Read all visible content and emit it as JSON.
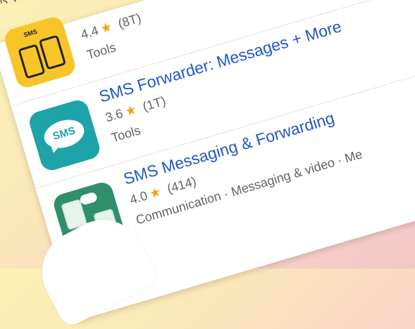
{
  "header_text": [
    "गए ऐसे डोमेन फेल"
  ],
  "apps": [
    {
      "name": "",
      "rating": "4.4",
      "reviews": "(8T)",
      "category": "Tools",
      "icon": "sms-phones-icon",
      "icon_color": "#f7c52a"
    },
    {
      "name": "SMS Forwarder: Messages + More",
      "rating": "3.6",
      "reviews": "(1T)",
      "category": "Tools",
      "icon": "sms-bubble-icon",
      "icon_color": "#1ea3a8",
      "icon_text": "SMS"
    },
    {
      "name": "SMS Messaging & Forwarding",
      "rating": "4.0",
      "reviews": "(414)",
      "category": "Communication · Messaging & video · Me",
      "icon": "sms-forward-icon",
      "icon_color": "#2f8f6a"
    }
  ],
  "star_glyph": "★",
  "star_color": "#f0a500",
  "title_color": "#2257c7"
}
